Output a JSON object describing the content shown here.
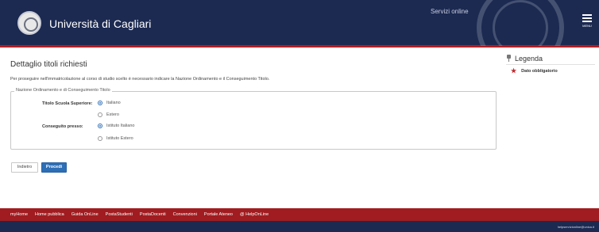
{
  "header": {
    "university_name": "Università di Cagliari",
    "services_label": "Servizi online",
    "menu_label": "MENU",
    "colors": {
      "navy": "#1c2a52",
      "red": "#b01f24"
    }
  },
  "main": {
    "title": "Dettaglio titoli richiesti",
    "intro": "Per proseguire nell'immatricolazione al corso di studio scelto è necessario indicare la Nazione Ordinamento e il Conseguimento Titolo.",
    "fieldset_legend": "Nazione Ordinamento e di Conseguimento Titolo",
    "fields": [
      {
        "label": "Titolo Scuola Superiore:",
        "options": [
          {
            "label": "Italiano",
            "checked": true
          },
          {
            "label": "Estero",
            "checked": false
          }
        ]
      },
      {
        "label": "Conseguito presso:",
        "options": [
          {
            "label": "Istituto Italiano",
            "checked": true
          },
          {
            "label": "Istituto Estero",
            "checked": false
          }
        ]
      }
    ],
    "buttons": {
      "back": "Indietro",
      "next": "Procedi"
    }
  },
  "legend_panel": {
    "title": "Legenda",
    "items": [
      {
        "icon": "star-icon",
        "label": "Dato obbligatorio"
      }
    ]
  },
  "footer": {
    "links": [
      "myHome",
      "Home pubblica",
      "Guida OnLine",
      "PostaStudenti",
      "PostaDocenti",
      "Convenzioni",
      "Portale Ateneo",
      "@ HelpOnLine"
    ],
    "email": "helpservizionline@unica.it"
  }
}
